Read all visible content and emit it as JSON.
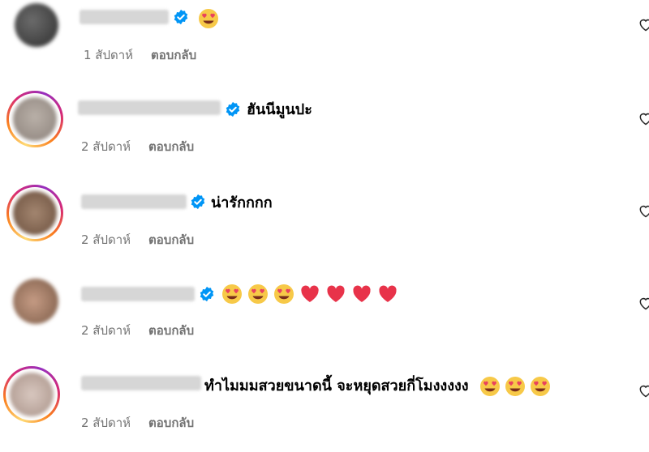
{
  "comments": [
    {
      "text": "",
      "emojis": [
        "heart-eyes"
      ],
      "time": "1 สัปดาห์",
      "reply_label": "ตอบกลับ"
    },
    {
      "text": "ฮันนีมูนปะ",
      "emojis": [],
      "time": "2 สัปดาห์",
      "reply_label": "ตอบกลับ"
    },
    {
      "text": "น่ารักกกก",
      "emojis": [],
      "time": "2 สัปดาห์",
      "reply_label": "ตอบกลับ"
    },
    {
      "text": "",
      "emojis": [
        "heart-eyes",
        "heart-eyes",
        "heart-eyes",
        "red-heart",
        "red-heart",
        "red-heart",
        "red-heart"
      ],
      "time": "2 สัปดาห์",
      "reply_label": "ตอบกลับ"
    },
    {
      "text": "ทำไมมมสวยขนาดนี้ จะหยุดสวยกี่โมงงงงง",
      "emojis": [
        "heart-eyes",
        "heart-eyes",
        "heart-eyes"
      ],
      "time": "2 สัปดาห์",
      "reply_label": "ตอบกลับ"
    }
  ],
  "colors": {
    "verified": "#0095f6",
    "muted": "#737373"
  }
}
